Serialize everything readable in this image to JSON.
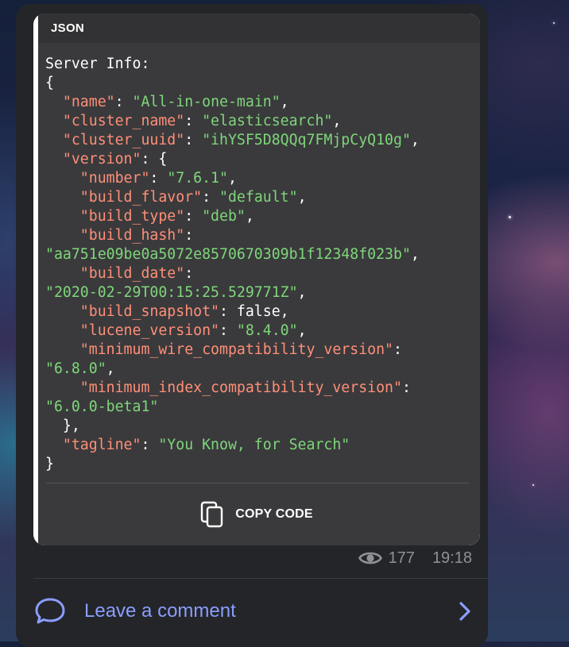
{
  "code_block": {
    "language": "JSON",
    "lines": [
      [
        {
          "t": "Server Info:",
          "c": "plain"
        }
      ],
      [
        {
          "t": "{",
          "c": "plain"
        }
      ],
      [
        {
          "t": "  \"name\"",
          "c": "k"
        },
        {
          "t": ": ",
          "c": "p"
        },
        {
          "t": "\"All-in-one-main\"",
          "c": "s"
        },
        {
          "t": ",",
          "c": "p"
        }
      ],
      [
        {
          "t": "  \"cluster_name\"",
          "c": "k"
        },
        {
          "t": ": ",
          "c": "p"
        },
        {
          "t": "\"elasticsearch\"",
          "c": "s"
        },
        {
          "t": ",",
          "c": "p"
        }
      ],
      [
        {
          "t": "  \"cluster_uuid\"",
          "c": "k"
        },
        {
          "t": ": ",
          "c": "p"
        },
        {
          "t": "\"ihYSF5D8QQq7FMjpCyQ10g\"",
          "c": "s"
        },
        {
          "t": ",",
          "c": "p"
        }
      ],
      [
        {
          "t": "  \"version\"",
          "c": "k"
        },
        {
          "t": ": {",
          "c": "p"
        }
      ],
      [
        {
          "t": "    \"number\"",
          "c": "k"
        },
        {
          "t": ": ",
          "c": "p"
        },
        {
          "t": "\"7.6.1\"",
          "c": "s"
        },
        {
          "t": ",",
          "c": "p"
        }
      ],
      [
        {
          "t": "    \"build_flavor\"",
          "c": "k"
        },
        {
          "t": ": ",
          "c": "p"
        },
        {
          "t": "\"default\"",
          "c": "s"
        },
        {
          "t": ",",
          "c": "p"
        }
      ],
      [
        {
          "t": "    \"build_type\"",
          "c": "k"
        },
        {
          "t": ": ",
          "c": "p"
        },
        {
          "t": "\"deb\"",
          "c": "s"
        },
        {
          "t": ",",
          "c": "p"
        }
      ],
      [
        {
          "t": "    \"build_hash\"",
          "c": "k"
        },
        {
          "t": ":",
          "c": "p"
        }
      ],
      [
        {
          "t": "\"aa751e09be0a5072e8570670309b1f12348f023b\"",
          "c": "s"
        },
        {
          "t": ",",
          "c": "p"
        }
      ],
      [
        {
          "t": "    \"build_date\"",
          "c": "k"
        },
        {
          "t": ":",
          "c": "p"
        }
      ],
      [
        {
          "t": "\"2020-02-29T00:15:25.529771Z\"",
          "c": "s"
        },
        {
          "t": ",",
          "c": "p"
        }
      ],
      [
        {
          "t": "    \"build_snapshot\"",
          "c": "k"
        },
        {
          "t": ": false,",
          "c": "p"
        }
      ],
      [
        {
          "t": "    \"lucene_version\"",
          "c": "k"
        },
        {
          "t": ": ",
          "c": "p"
        },
        {
          "t": "\"8.4.0\"",
          "c": "s"
        },
        {
          "t": ",",
          "c": "p"
        }
      ],
      [
        {
          "t": "    \"minimum_wire_compatibility_version\"",
          "c": "k"
        },
        {
          "t": ":",
          "c": "p"
        }
      ],
      [
        {
          "t": "\"6.8.0\"",
          "c": "s"
        },
        {
          "t": ",",
          "c": "p"
        }
      ],
      [
        {
          "t": "    \"minimum_index_compatibility_version\"",
          "c": "k"
        },
        {
          "t": ":",
          "c": "p"
        }
      ],
      [
        {
          "t": "\"6.0.0-beta1\"",
          "c": "s"
        }
      ],
      [
        {
          "t": "  },",
          "c": "p"
        }
      ],
      [
        {
          "t": "  \"tagline\"",
          "c": "k"
        },
        {
          "t": ": ",
          "c": "p"
        },
        {
          "t": "\"You Know, for Search\"",
          "c": "s"
        }
      ],
      [
        {
          "t": "}",
          "c": "p"
        }
      ]
    ],
    "copy_label": "COPY CODE",
    "copy_icon": "copy-icon"
  },
  "message_meta": {
    "views_icon": "eye-icon",
    "views": "177",
    "time": "19:18"
  },
  "comment": {
    "icon": "comment-bubble-icon",
    "label": "Leave a comment",
    "arrow_icon": "chevron-right-icon"
  },
  "colors": {
    "key": "#ff8f78",
    "string": "#7fd67b",
    "link": "#8b9dff",
    "bubble": "#232528",
    "code_bg": "#3a3a3c"
  }
}
